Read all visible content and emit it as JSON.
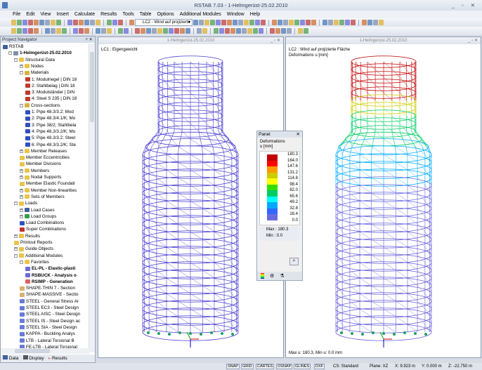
{
  "app": {
    "title": "RSTAB 7.03 - 1-Helmgerüst-25.02.2010"
  },
  "menu": [
    "File",
    "Edit",
    "View",
    "Insert",
    "Calculate",
    "Results",
    "Tools",
    "Table",
    "Options",
    "Additional Modules",
    "Window",
    "Help"
  ],
  "toolbar": {
    "load_case": "LC2 - Wind auf projizierte"
  },
  "navigator": {
    "title": "Project Navigator",
    "items": [
      {
        "label": "RSTAB",
        "level": 0,
        "icon": "rstab-icon",
        "color": "#3f5f9a"
      },
      {
        "label": "1-Helmgerüst-25.02.2010",
        "level": 1,
        "icon": "model-icon",
        "color": "#7f8fa8",
        "bold": true,
        "pm": "-"
      },
      {
        "label": "Structural Data",
        "level": 2,
        "icon": "folder-icon",
        "color": "#e8c44a",
        "pm": "-"
      },
      {
        "label": "Nodes",
        "level": 3,
        "icon": "folder-icon",
        "color": "#e8c44a",
        "pm": "+"
      },
      {
        "label": "Materials",
        "level": 3,
        "icon": "folder-icon",
        "color": "#d8b040",
        "pm": "-"
      },
      {
        "label": "1: Modulriegel | DIN 18",
        "level": 4,
        "icon": "material-icon",
        "color": "#c03a2b"
      },
      {
        "label": "2: Stahlbelag | DIN 18",
        "level": 4,
        "icon": "material-icon",
        "color": "#c03a2b"
      },
      {
        "label": "3: Modulständer | DIN",
        "level": 4,
        "icon": "material-icon",
        "color": "#c03a2b"
      },
      {
        "label": "4: Steel S 235 | DIN 18",
        "level": 4,
        "icon": "material-icon",
        "color": "#c03a2b"
      },
      {
        "label": "Cross-sections",
        "level": 3,
        "icon": "folder-icon",
        "color": "#d8b040",
        "pm": "-"
      },
      {
        "label": "1: Pipe 48.3/3.2; Mod",
        "level": 4,
        "icon": "section-icon",
        "color": "#3050c0"
      },
      {
        "label": "2: Pipe 48.3/4.1/K; Mo",
        "level": 4,
        "icon": "section-icon",
        "color": "#3050c0"
      },
      {
        "label": "3: Pipe 38/2; Stahlbela",
        "level": 4,
        "icon": "section-icon",
        "color": "#3050c0"
      },
      {
        "label": "4: Pipe 48.3/3.2/K; Mo",
        "level": 4,
        "icon": "section-icon",
        "color": "#3050c0"
      },
      {
        "label": "5: Pipe 48.3/3.2; Steel",
        "level": 4,
        "icon": "section-icon",
        "color": "#3050c0"
      },
      {
        "label": "6: Pipe 48.3/3.2/K; Ste",
        "level": 4,
        "icon": "section-icon",
        "color": "#3050c0"
      },
      {
        "label": "Member Releases",
        "level": 3,
        "icon": "folder-icon",
        "color": "#e8c44a",
        "pm": "+"
      },
      {
        "label": "Member Eccentricities",
        "level": 3,
        "icon": "folder-icon",
        "color": "#e8c44a"
      },
      {
        "label": "Member Divisions",
        "level": 3,
        "icon": "folder-icon",
        "color": "#e8c44a"
      },
      {
        "label": "Members",
        "level": 3,
        "icon": "folder-icon",
        "color": "#e8c44a",
        "pm": "+"
      },
      {
        "label": "Nodal Supports",
        "level": 3,
        "icon": "folder-icon",
        "color": "#e8c44a",
        "pm": "+"
      },
      {
        "label": "Member Elastic Foundati",
        "level": 3,
        "icon": "folder-icon",
        "color": "#e8c44a"
      },
      {
        "label": "Member Non-linearities",
        "level": 3,
        "icon": "folder-icon",
        "color": "#e8c44a",
        "pm": "+"
      },
      {
        "label": "Sets of Members",
        "level": 3,
        "icon": "folder-icon",
        "color": "#e8c44a",
        "pm": "+"
      },
      {
        "label": "Loads",
        "level": 2,
        "icon": "folder-icon",
        "color": "#e8c44a",
        "pm": "-"
      },
      {
        "label": "Load Cases",
        "level": 3,
        "icon": "load-case-icon",
        "color": "#4060a0",
        "pm": "+"
      },
      {
        "label": "Load Groups",
        "level": 3,
        "icon": "load-group-icon",
        "color": "#30a050",
        "pm": "+"
      },
      {
        "label": "Load Combinations",
        "level": 3,
        "icon": "load-combination-icon",
        "color": "#3050c0"
      },
      {
        "label": "Super Combinations",
        "level": 3,
        "icon": "super-combination-icon",
        "color": "#c03030"
      },
      {
        "label": "Results",
        "level": 2,
        "icon": "folder-icon",
        "color": "#e8c44a",
        "pm": "+"
      },
      {
        "label": "Printout Reports",
        "level": 2,
        "icon": "folder-icon",
        "color": "#e8c44a"
      },
      {
        "label": "Guide Objects",
        "level": 2,
        "icon": "folder-icon",
        "color": "#e8c44a",
        "pm": "+"
      },
      {
        "label": "Additional Modules",
        "level": 2,
        "icon": "folder-icon",
        "color": "#e8c44a",
        "pm": "-"
      },
      {
        "label": "Favorites",
        "level": 3,
        "icon": "folder-icon",
        "color": "#e8c44a",
        "pm": "-"
      },
      {
        "label": "EL-PL - Elastic-plasti",
        "level": 4,
        "icon": "module-icon",
        "color": "#6a6ad8",
        "bold": true
      },
      {
        "label": "RSBUCK - Analysis o",
        "level": 4,
        "icon": "module-icon",
        "color": "#6a6ad8",
        "bold": true
      },
      {
        "label": "RSIMP - Generation",
        "level": 4,
        "icon": "module-icon",
        "color": "#e06060",
        "bold": true
      },
      {
        "label": "SHAPE-THIN 7 - Section",
        "level": 3,
        "icon": "module-icon",
        "color": "#d8b070"
      },
      {
        "label": "SHAPE-MASSIVE - Sectio",
        "level": 3,
        "icon": "module-icon",
        "color": "#d8b070"
      },
      {
        "label": "STEEL - General Stress Ar",
        "level": 3,
        "icon": "module-icon",
        "color": "#6a7ad8"
      },
      {
        "label": "STEEL EC3 - Steel Design",
        "level": 3,
        "icon": "module-icon",
        "color": "#6a7ad8"
      },
      {
        "label": "STEEL AISC - Steel Design",
        "level": 3,
        "icon": "module-icon",
        "color": "#6a7ad8"
      },
      {
        "label": "STEEL IS - Steel Design ac",
        "level": 3,
        "icon": "module-icon",
        "color": "#6a7ad8"
      },
      {
        "label": "STEEL SIA - Steel Design",
        "level": 3,
        "icon": "module-icon",
        "color": "#6a7ad8"
      },
      {
        "label": "KAPPA - Buckling Analys",
        "level": 3,
        "icon": "module-icon",
        "color": "#6a7ad8"
      },
      {
        "label": "LTB - Lateral Torsional B",
        "level": 3,
        "icon": "module-icon",
        "color": "#6a7ad8"
      },
      {
        "label": "FE-LTB - Lateral Torsional",
        "level": 3,
        "icon": "module-icon",
        "color": "#6a7ad8"
      }
    ],
    "tabs": [
      "Data",
      "Display",
      "Results"
    ]
  },
  "windows": [
    {
      "title": "1-Helmgerüst-25.02.2010",
      "label": "LC1 : Eigengewicht"
    },
    {
      "title": "1-Helmgerüst-25.02.2010",
      "label": "LC2 : Wind auf projizierte Fläche",
      "sublabel": "Deformations u [mm]",
      "footer": "Max u: 180.3, Min u: 0.0 mm"
    }
  ],
  "panel": {
    "title": "Panel",
    "heading": "Deformations",
    "unit": "u [mm]",
    "scale": [
      {
        "value": "180.3",
        "color": "#c00000"
      },
      {
        "value": "164.0",
        "color": "#ff0000"
      },
      {
        "value": "147.6",
        "color": "#ff9900"
      },
      {
        "value": "131.2",
        "color": "#cccc00"
      },
      {
        "value": "114.8",
        "color": "#ffff00"
      },
      {
        "value": "98.4",
        "color": "#33dd00"
      },
      {
        "value": "82.0",
        "color": "#00cc66"
      },
      {
        "value": "65.6",
        "color": "#00ffff"
      },
      {
        "value": "49.2",
        "color": "#00aaff"
      },
      {
        "value": "32.8",
        "color": "#3366ff"
      },
      {
        "value": "16.4",
        "color": "#6a6ae0"
      },
      {
        "value": "0.0",
        "color": "#4a4a9a"
      }
    ],
    "max_label": "Max",
    "max": "180.3",
    "min_label": "Min",
    "min": "0.0"
  },
  "status": {
    "buttons": [
      "SNAP",
      "GRID",
      "CARTES",
      "OSNAP",
      "GLINES",
      "DXF"
    ],
    "cs": "CS: Standard",
    "plane": "Plane: XZ",
    "x": "X: 9.923 m",
    "y": "Y: 0.000 m",
    "z": "Z: -22.750 m"
  }
}
